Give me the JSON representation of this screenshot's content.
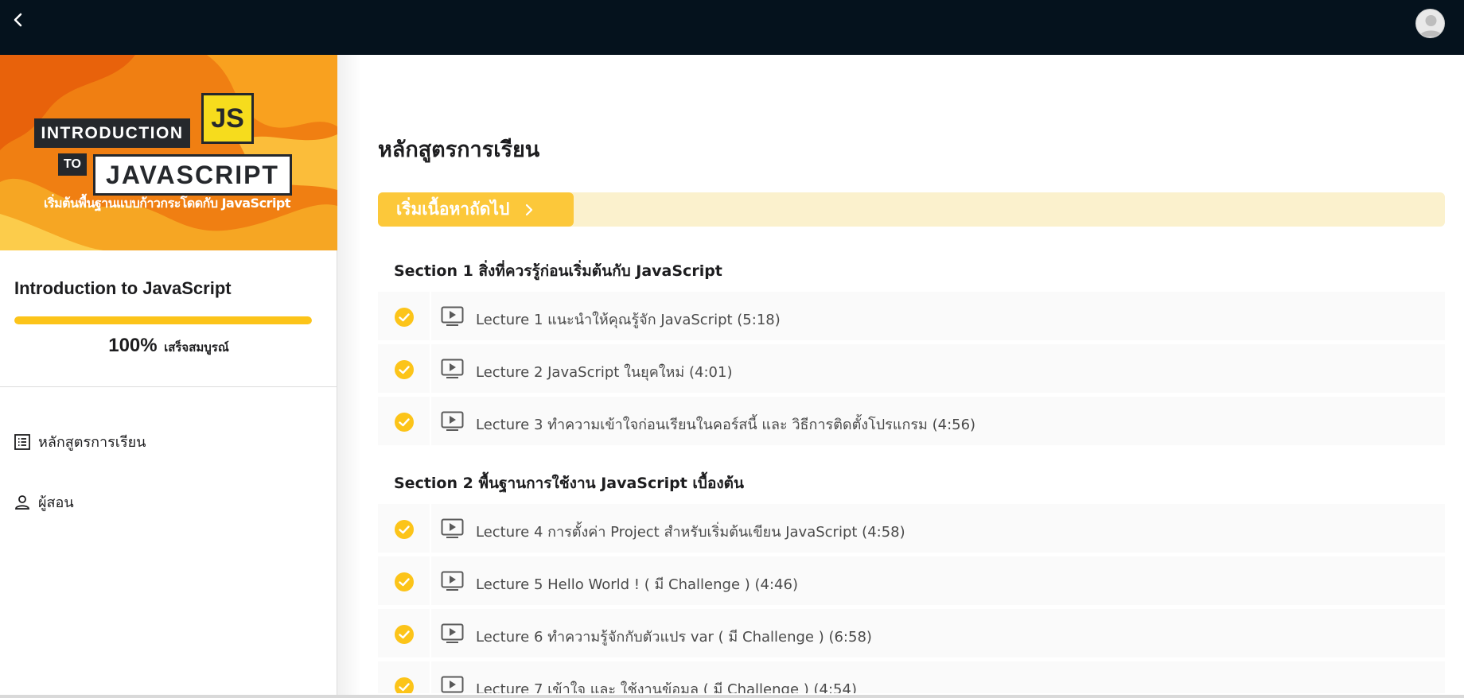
{
  "app": {
    "back_icon": "chevron-left-icon",
    "avatar_icon": "user-avatar-icon"
  },
  "banner": {
    "line1": "INTRODUCTION",
    "line2": "TO",
    "line3": "JAVASCRIPT",
    "badge": "JS",
    "tagline": "เริ่มต้นพื้นฐานแบบก้าวกระโดดกับ JavaScript"
  },
  "sidebar": {
    "course_title": "Introduction to JavaScript",
    "progress_value": "100%",
    "progress_fraction": 1.0,
    "progress_label": "เสร็จสมบูรณ์",
    "nav": [
      {
        "label": "หลักสูตรการเรียน",
        "icon": "list-icon"
      },
      {
        "label": "ผู้สอน",
        "icon": "person-icon"
      }
    ]
  },
  "main": {
    "page_title": "หลักสูตรการเรียน",
    "next_button_label": "เริ่มเนื้อหาถัดไป",
    "sections": [
      {
        "title": "Section 1 สิ่งที่ควรรู้ก่อนเริ่มต้นกับ JavaScript",
        "lectures": [
          {
            "title": "Lecture 1 แนะนำให้คุณรู้จัก JavaScript (5:18)",
            "completed": true
          },
          {
            "title": "Lecture 2 JavaScript ในยุคใหม่ (4:01)",
            "completed": true
          },
          {
            "title": "Lecture 3 ทำความเข้าใจก่อนเรียนในคอร์สนี้ และ วิธีการติดตั้งโปรแกรม (4:56)",
            "completed": true
          }
        ]
      },
      {
        "title": "Section 2 พื้นฐานการใช้งาน JavaScript เบื้องต้น",
        "lectures": [
          {
            "title": "Lecture 4 การตั้งค่า Project สำหรับเริ่มต้นเขียน JavaScript (4:58)",
            "completed": true
          },
          {
            "title": "Lecture 5 Hello World ! ( มี Challenge ) (4:46)",
            "completed": true
          },
          {
            "title": "Lecture 6 ทำความรู้จักกับตัวแปร var ( มี Challenge ) (6:58)",
            "completed": true
          },
          {
            "title": "Lecture 7 เข้าใจ และ ใช้งานข้อมูล ( มี Challenge ) (4:54)",
            "completed": true
          }
        ]
      }
    ]
  },
  "colors": {
    "topbar": "#05121d",
    "accent": "#fcc419",
    "next_button": "#fcc83a",
    "next_bar_bg": "#fbf1cd"
  }
}
